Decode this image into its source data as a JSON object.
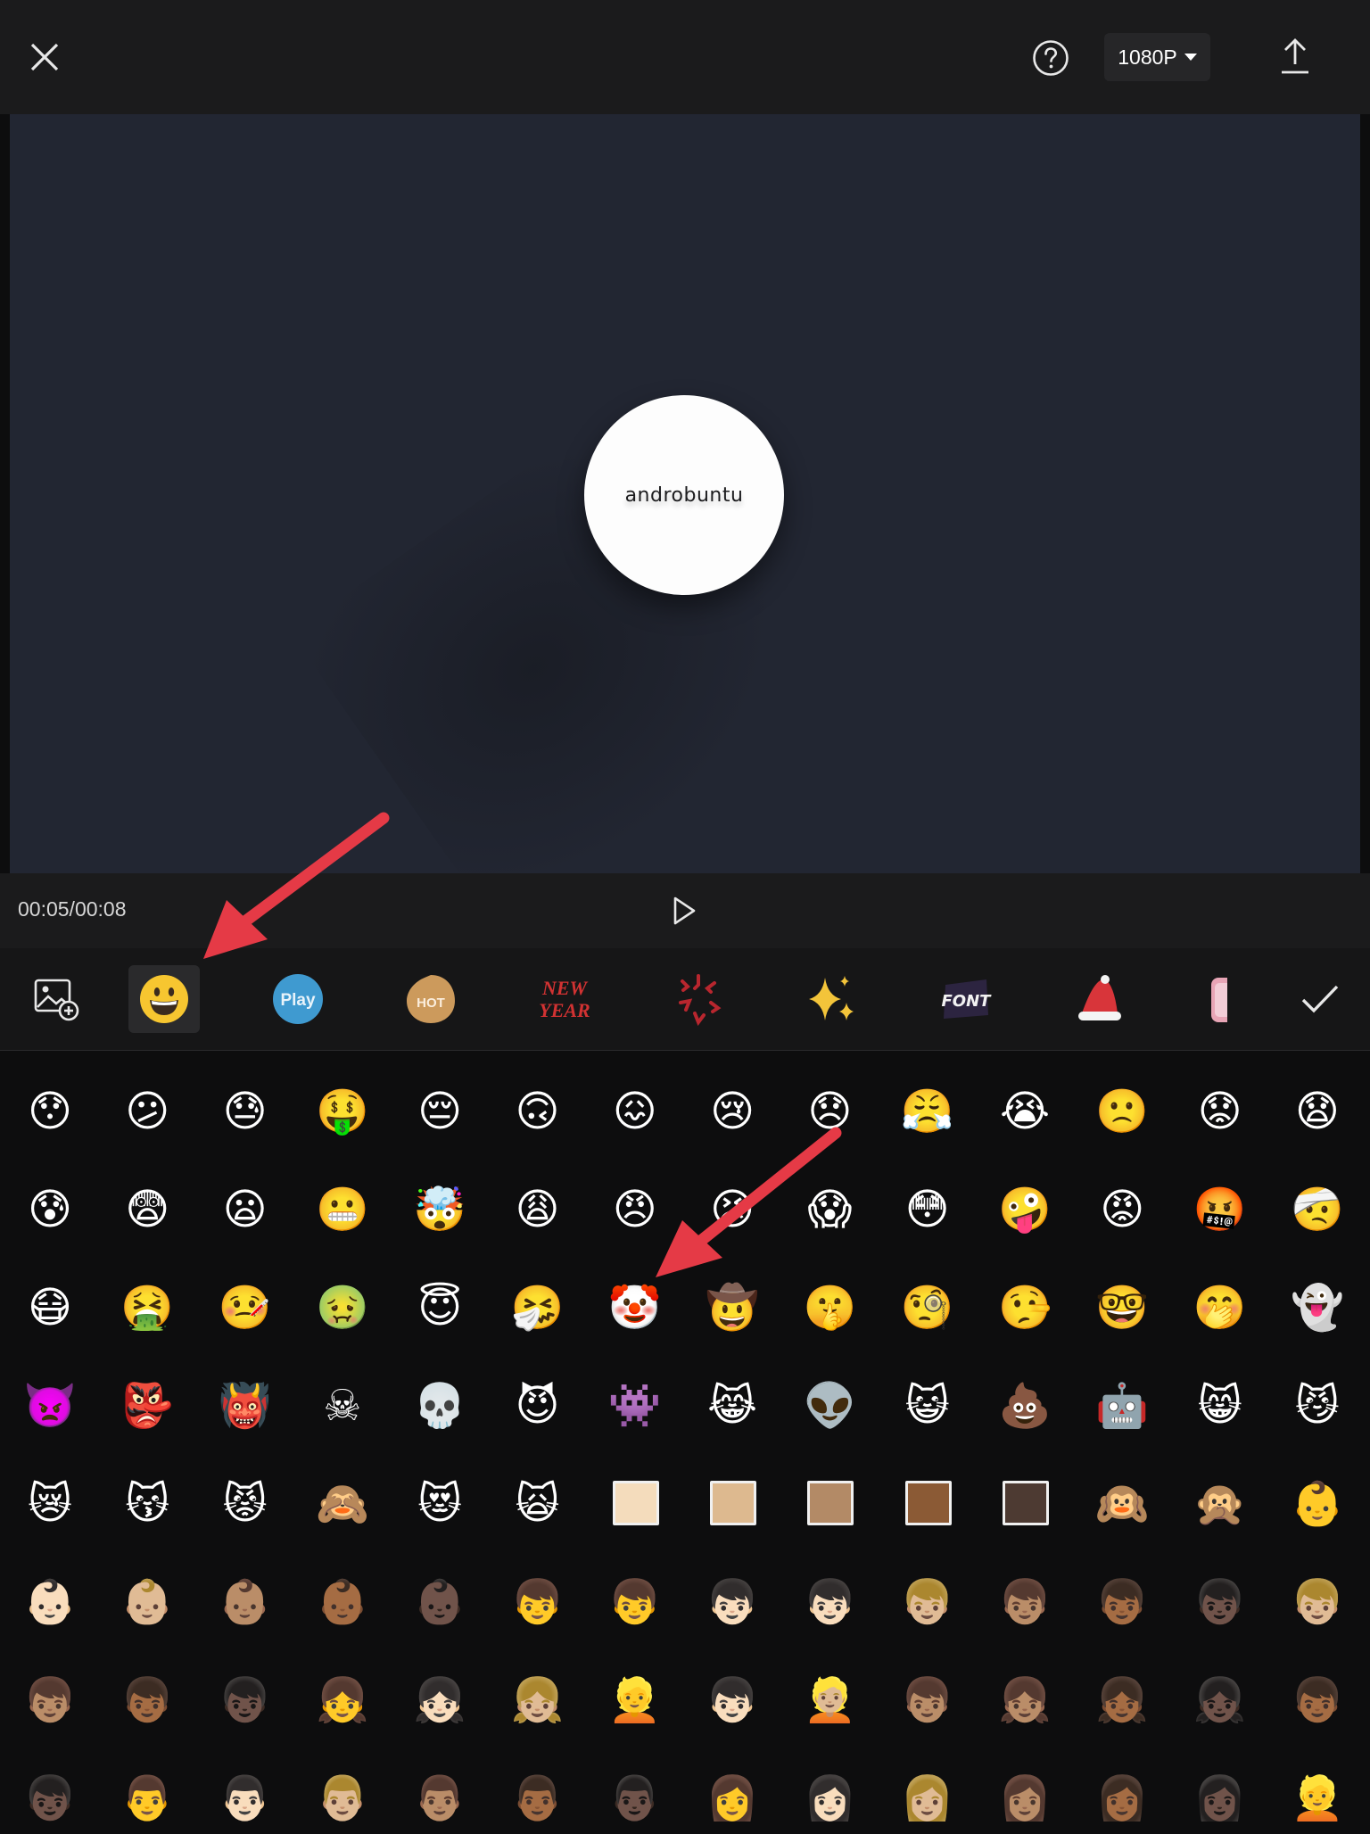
{
  "topbar": {
    "resolution": "1080P",
    "icons": [
      "close-icon",
      "help-icon",
      "caret-down-icon",
      "export-icon"
    ]
  },
  "preview": {
    "logo_text": "androbuntu",
    "background": "#222632"
  },
  "playbar": {
    "timecode": "00:05/00:08"
  },
  "sticker_bar": {
    "tabs": [
      "add-image",
      "emoji",
      "play",
      "hot",
      "new-year",
      "burst",
      "sparkles",
      "font",
      "santa-hat",
      "love"
    ],
    "selected": "emoji",
    "play_label": "Play",
    "hot_label": "HOT",
    "new_year_line1": "NEW",
    "new_year_line2": "YEAR",
    "font_label": "FONT"
  },
  "emoji_grid": {
    "row1": [
      "😯",
      "😕",
      "😓",
      "🤑",
      "😔",
      "🙃",
      "😖",
      "😢",
      "😞",
      "😤",
      "😭",
      "🙁",
      "😟",
      "😧"
    ],
    "row2": [
      "😰",
      "😨",
      "😦",
      "😬",
      "🤯",
      "😩",
      "😠",
      "😣",
      "😱",
      "😳",
      "🤪",
      "😡",
      "🤬",
      "🤕"
    ],
    "row3": [
      "😷",
      "🤮",
      "🤒",
      "🤢",
      "😇",
      "🤧",
      "🤡",
      "🤠",
      "🤫",
      "🧐",
      "🤥",
      "🤓",
      "🤭",
      "👻"
    ],
    "row4": [
      "👿",
      "👺",
      "👹",
      "☠",
      "💀",
      "😈",
      "👾",
      "😹",
      "👽",
      "😺",
      "💩",
      "🤖",
      "😸",
      "😼"
    ],
    "row5": [
      "😿",
      "😽",
      "😾",
      "🙈",
      "😻",
      "🙀",
      "",
      "",
      "",
      "",
      "",
      "🙉",
      "🙊",
      "👶"
    ],
    "row6": [
      "👶🏻",
      "👶🏼",
      "👶🏽",
      "👶🏾",
      "👶🏿",
      "👦",
      "👦",
      "👦🏻",
      "👦🏻",
      "👦🏼",
      "👦🏽",
      "👦🏾",
      "👦🏿",
      "👦🏼"
    ],
    "row7": [
      "👦🏽",
      "👦🏾",
      "👦🏿",
      "👧",
      "👧🏻",
      "👧🏼",
      "👱",
      "👦🏻",
      "👱🏼",
      "👦🏽",
      "👧🏽",
      "👧🏾",
      "👧🏿",
      "👦🏾"
    ],
    "row8": [
      "👦🏿",
      "👨",
      "👨🏻",
      "👨🏼",
      "👨🏽",
      "👨🏾",
      "👨🏿",
      "👩",
      "👩🏻",
      "👩🏼",
      "👩🏽",
      "👩🏾",
      "👩🏿",
      "👱"
    ],
    "skin_tones": [
      "#f4dcbc",
      "#ddb98f",
      "#b38a66",
      "#8b5a35",
      "#4d3a32"
    ]
  },
  "colors": {
    "accent_arrow": "#e53a46",
    "topbar": "#1b1b1c",
    "panel": "#0d0d0e"
  }
}
